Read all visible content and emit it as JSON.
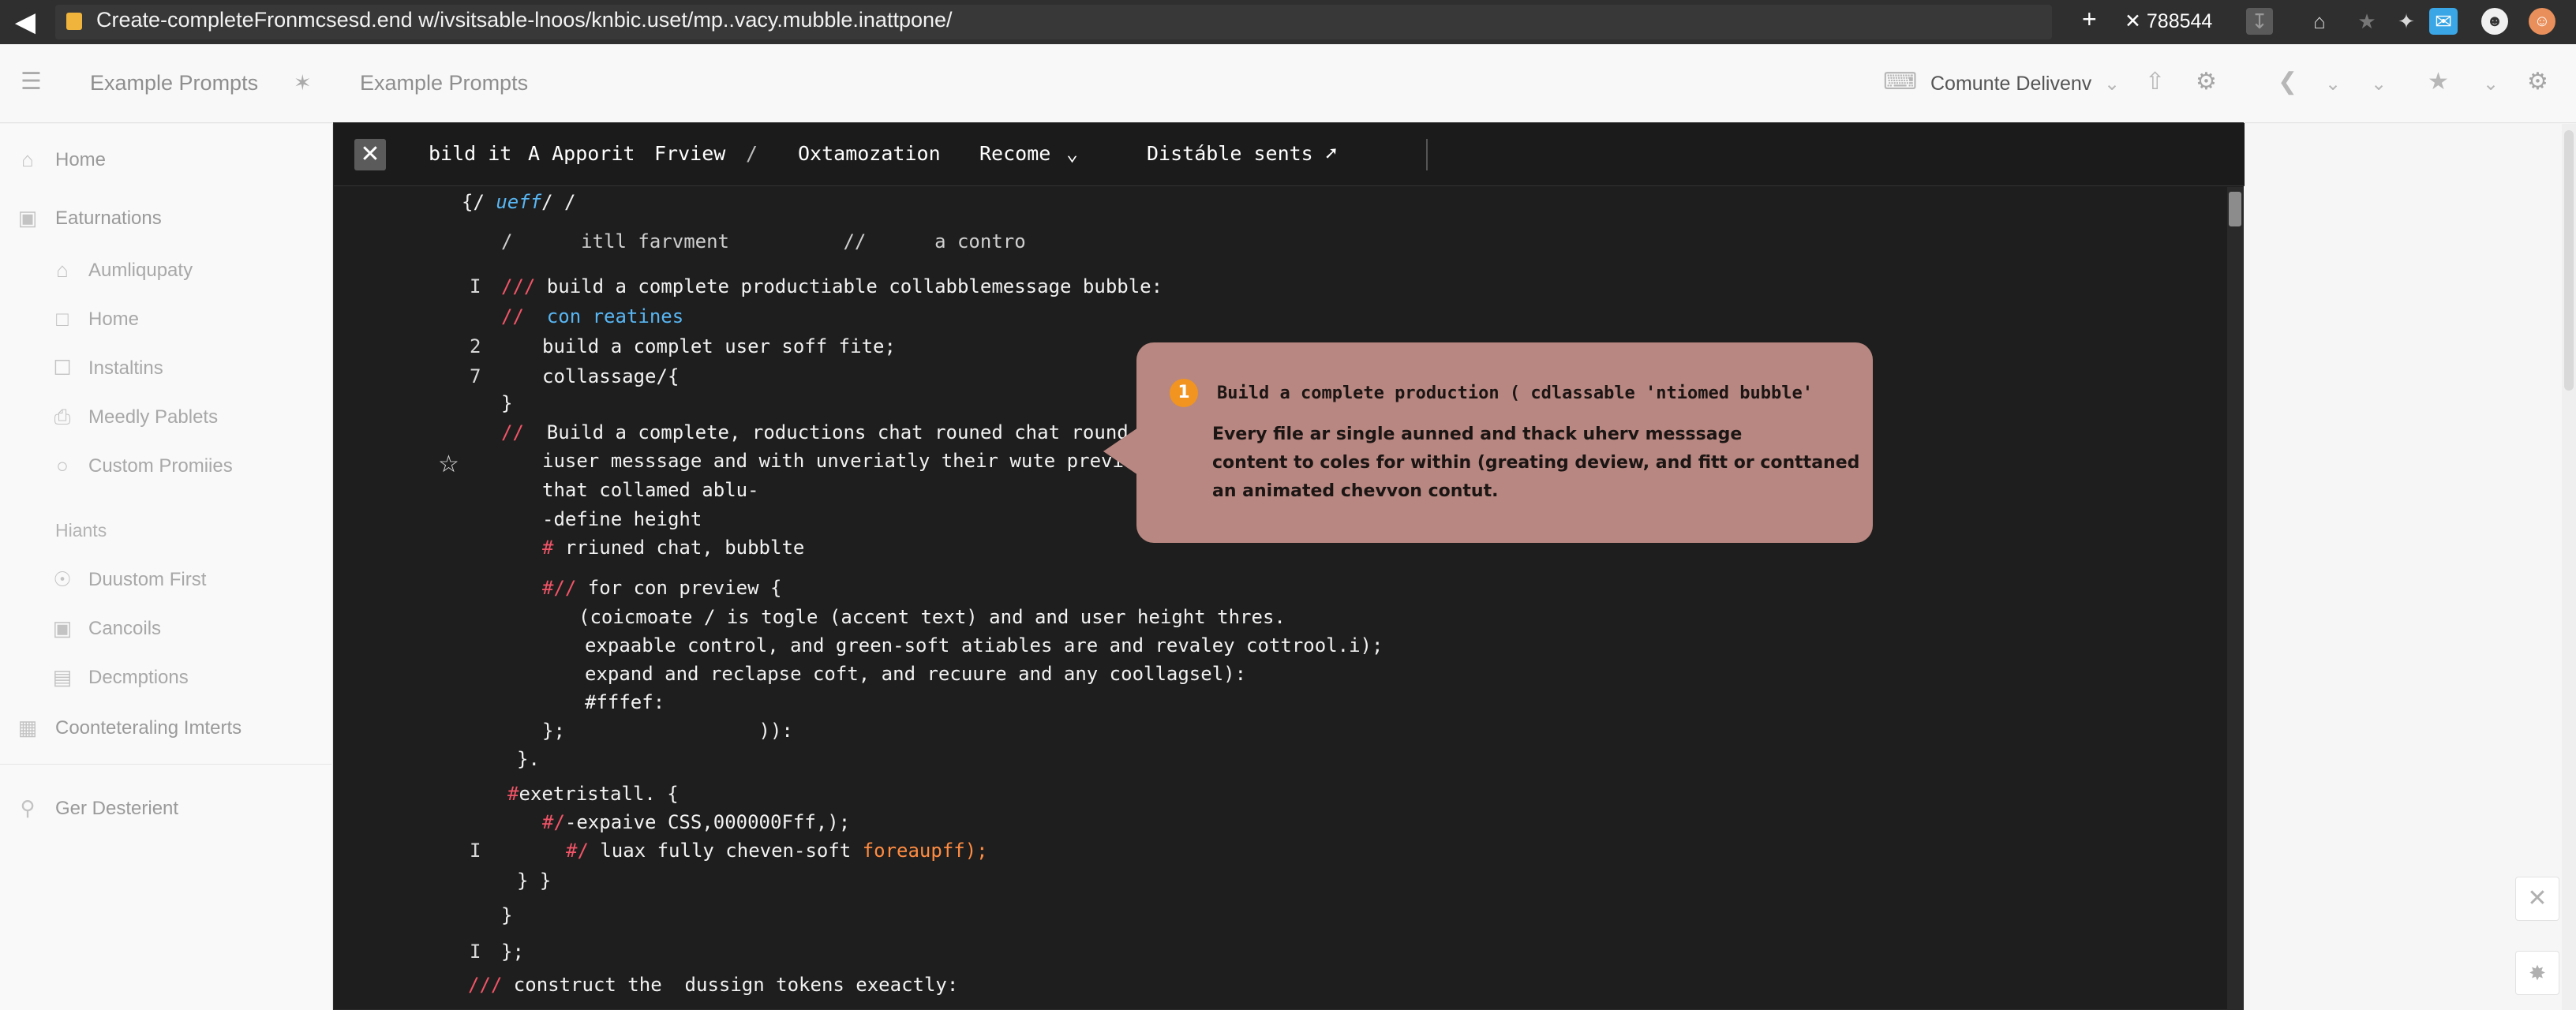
{
  "browser": {
    "back_icon": "arrow-left-icon",
    "url": "Create-completeFronmcsesd.end w/ivsitsable-lnoos/knbic.uset/mp..vacy.mubble.inattpone/",
    "counter": "✕ 788544"
  },
  "header": {
    "crumb_a": "Example Prompts",
    "crumb_b": "Example Prompts",
    "delivery": "Comunte Delivenv"
  },
  "sidebar": {
    "items": [
      {
        "label": "Home",
        "icon": "home-icon"
      },
      {
        "label": "Eaturnations",
        "icon": "grid-icon"
      },
      {
        "label": "Aumliqupaty",
        "icon": "house-icon"
      },
      {
        "label": "Home",
        "icon": "square-icon"
      },
      {
        "label": "Instaltins",
        "icon": "file-icon"
      },
      {
        "label": "Meedly Pablets",
        "icon": "printer-icon"
      },
      {
        "label": "Custom Promiies",
        "icon": "circle-icon"
      },
      {
        "label": "Duustom First",
        "icon": "gauge-icon"
      },
      {
        "label": "Cancoils",
        "icon": "window-icon"
      },
      {
        "label": "Decmptions",
        "icon": "list-box-icon"
      },
      {
        "label": "Coonteteraling Imterts",
        "icon": "table-icon"
      },
      {
        "label": "Ger Desterient",
        "icon": "search-icon"
      }
    ],
    "section_hiants": "Hiants"
  },
  "toolbar": {
    "items": [
      "bild it",
      "A Apporit",
      "Frview",
      "/",
      "Oxtamozation",
      "Recome",
      "Distáble sents"
    ]
  },
  "code": {
    "l1a": "{/ ",
    "l1b": "ueff",
    "l1c": "/ /",
    "l2": "/      itll farvment          //      a contro",
    "l3a": "///",
    "l3b": " build a complete productiable collabblemessage bubble:",
    "l4a": "//",
    "l4b": "  con reatines",
    "l5": "build a complet user soff fite;",
    "l6": "collassage/{",
    "l7": "}",
    "l8a": "//",
    "l8b": "  Build a complete, roductions chat rouned chat round",
    "l9": "iuser messsage and with unveriatly their wute preview",
    "l10": "that collamed ablu-",
    "l11": "-define height",
    "l12a": "#",
    "l12b": " rriuned chat, bubblte",
    "l13a": "#//",
    "l13b": " for con preview {",
    "l14": "(coicmoate / is togle (accent text) and and user height thres.",
    "l15": "expaable control, and green-soft atiables are and revaley cottrool.i);",
    "l16": "expand and reclapse coft, and recuure and any coollagsel):",
    "l17": "#fffef:",
    "l18": "};                 )):",
    "l19": "}.",
    "l20a": "#",
    "l20b": "exetristall. {",
    "l21a": "#/",
    "l21b": "-expaive CSS,000000Fff,);",
    "l22a": "#/",
    "l22b": " luax fully cheven-soft ",
    "l22c": "foreaupff);",
    "l23": "} }",
    "l24": "}",
    "l25": "};",
    "l26a": "///",
    "l26b": " construct the  dussign tokens exeactly:",
    "gutter": {
      "g1": "I",
      "g2": "2",
      "g3": "7",
      "g4": "I",
      "g5": "I"
    }
  },
  "tooltip": {
    "badge": "1",
    "title": "Build a complete production ( cdlassable 'ntiomed bubble'",
    "line1": "Every file ar single aunned and thack uherv messsage",
    "line2": "content to coles for within (greating deview, and fitt or conttaned",
    "line3": "an animated chevvon contut."
  },
  "colors": {
    "accent_red": "#f25467",
    "accent_blue": "#58b6f3",
    "accent_orange": "#ff8c42",
    "tooltip_bg": "#b88781"
  }
}
